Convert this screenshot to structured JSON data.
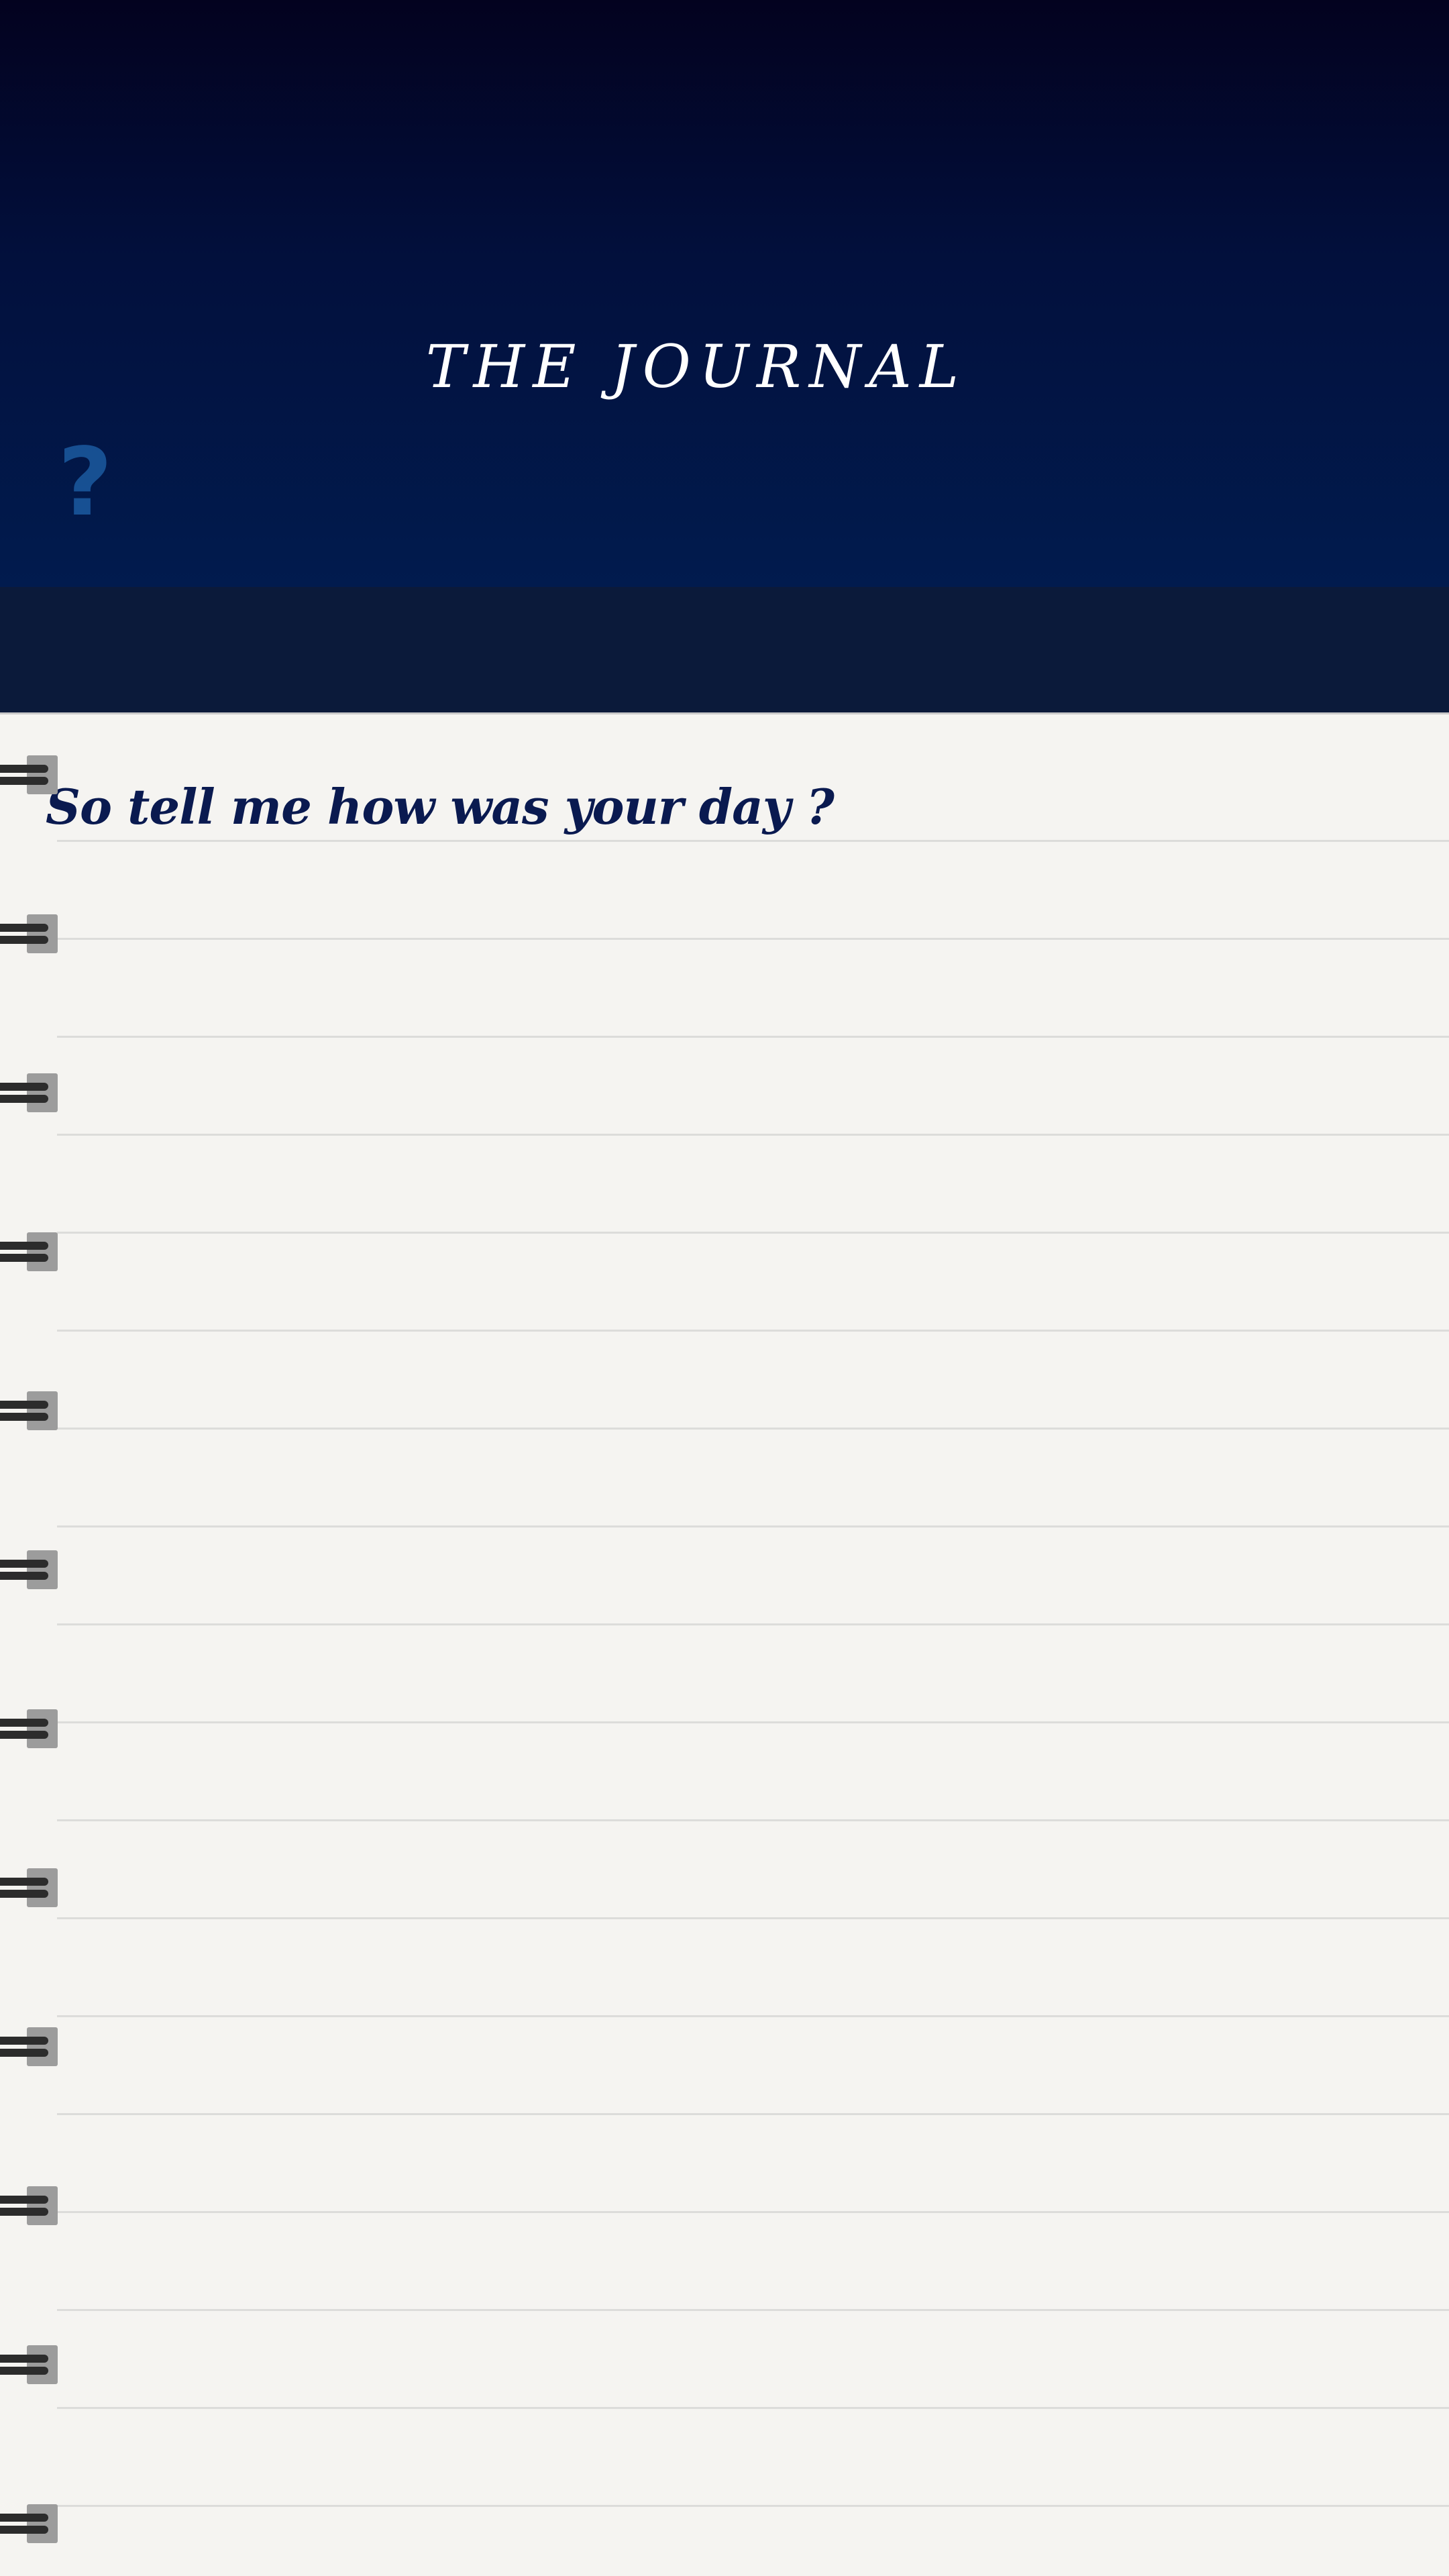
{
  "header": {
    "title": "THE JOURNAL",
    "help_label": "?"
  },
  "journal": {
    "prompt": "So tell me how was your day ?"
  },
  "colors": {
    "header_top": "#03021f",
    "header_bottom": "#011b4e",
    "band": "#0b1a3a",
    "paper": "#f5f4f1",
    "prompt_text": "#0a1a50",
    "help_icon": "#1b5aa0"
  },
  "icons": {
    "help": "question-mark-icon",
    "binding": "spiral-ring-icon"
  }
}
